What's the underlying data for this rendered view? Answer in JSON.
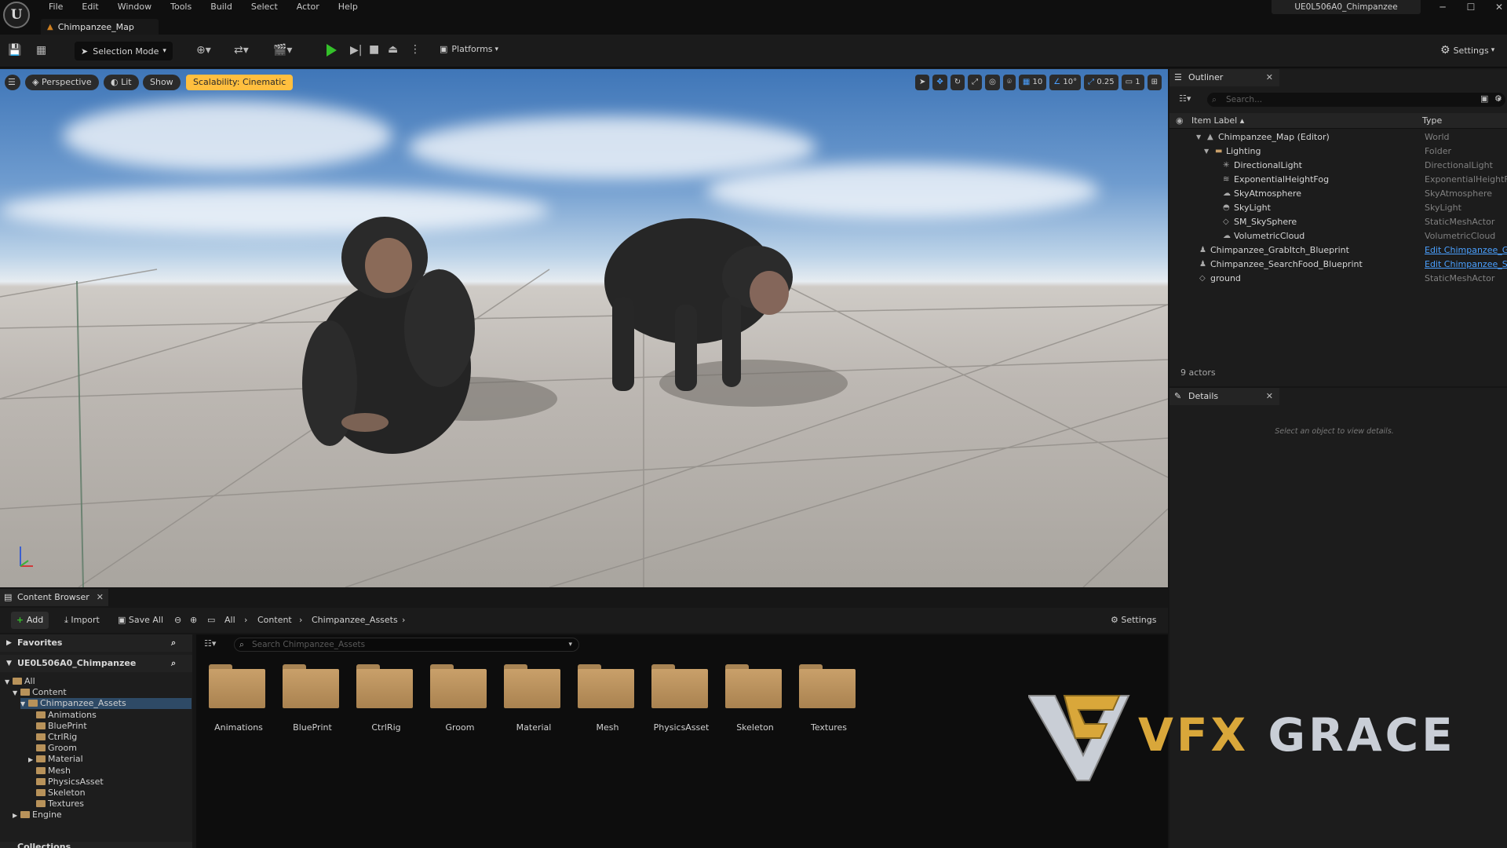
{
  "window": {
    "menu": [
      "File",
      "Edit",
      "Window",
      "Tools",
      "Build",
      "Select",
      "Actor",
      "Help"
    ],
    "map_tab": "Chimpanzee_Map",
    "project_name": "UE0L506A0_Chimpanzee"
  },
  "toolbar": {
    "selection_mode": "Selection Mode",
    "platforms": "Platforms",
    "settings": "Settings"
  },
  "viewport": {
    "perspective": "Perspective",
    "lit": "Lit",
    "show": "Show",
    "scalability": "Scalability: Cinematic",
    "grid_snap": "10",
    "rotation_snap": "10°",
    "scale_snap": "0.25",
    "camera_speed": "1"
  },
  "outliner": {
    "tab": "Outliner",
    "search_placeholder": "Search...",
    "col_label": "Item Label ▴",
    "col_type": "Type",
    "rows": [
      {
        "label": "Chimpanzee_Map (Editor)",
        "type": "World",
        "icon": "map-icon",
        "link": false
      },
      {
        "label": "Lighting",
        "type": "Folder",
        "icon": "folder-icon",
        "link": false
      },
      {
        "label": "DirectionalLight",
        "type": "DirectionalLight",
        "icon": "sun-icon",
        "link": false
      },
      {
        "label": "ExponentialHeightFog",
        "type": "ExponentialHeightFog",
        "icon": "fog-icon",
        "link": false
      },
      {
        "label": "SkyAtmosphere",
        "type": "SkyAtmosphere",
        "icon": "atmosphere-icon",
        "link": false
      },
      {
        "label": "SkyLight",
        "type": "SkyLight",
        "icon": "skylight-icon",
        "link": false
      },
      {
        "label": "SM_SkySphere",
        "type": "StaticMeshActor",
        "icon": "mesh-icon",
        "link": false
      },
      {
        "label": "VolumetricCloud",
        "type": "VolumetricCloud",
        "icon": "cloud-icon",
        "link": false
      },
      {
        "label": "Chimpanzee_GrabItch_Blueprint",
        "type": "Edit Chimpanzee_Gra",
        "icon": "actor-icon",
        "link": true
      },
      {
        "label": "Chimpanzee_SearchFood_Blueprint",
        "type": "Edit Chimpanzee_Se",
        "icon": "actor-icon",
        "link": true
      },
      {
        "label": "ground",
        "type": "StaticMeshActor",
        "icon": "mesh-icon",
        "link": false
      }
    ],
    "actor_count": "9 actors"
  },
  "details": {
    "tab": "Details",
    "empty_message": "Select an object to view details."
  },
  "content_browser": {
    "tab": "Content Browser",
    "add": "Add",
    "import": "Import",
    "save_all": "Save All",
    "breadcrumb": [
      "All",
      "Content",
      "Chimpanzee_Assets"
    ],
    "settings": "Settings",
    "favorites": "Favorites",
    "project": "UE0L506A0_Chimpanzee",
    "collections": "Collections",
    "search_placeholder": "Search Chimpanzee_Assets",
    "tree": [
      {
        "label": "All",
        "depth": 0
      },
      {
        "label": "Content",
        "depth": 1
      },
      {
        "label": "Chimpanzee_Assets",
        "depth": 2
      },
      {
        "label": "Animations",
        "depth": 3
      },
      {
        "label": "BluePrint",
        "depth": 3
      },
      {
        "label": "CtrlRig",
        "depth": 3
      },
      {
        "label": "Groom",
        "depth": 3
      },
      {
        "label": "Material",
        "depth": 3
      },
      {
        "label": "Mesh",
        "depth": 3
      },
      {
        "label": "PhysicsAsset",
        "depth": 3
      },
      {
        "label": "Skeleton",
        "depth": 3
      },
      {
        "label": "Textures",
        "depth": 3
      },
      {
        "label": "Engine",
        "depth": 1
      }
    ],
    "assets": [
      "Animations",
      "BluePrint",
      "CtrlRig",
      "Groom",
      "Material",
      "Mesh",
      "PhysicsAsset",
      "Skeleton",
      "Textures"
    ]
  },
  "watermark": {
    "text_gold": "VFX",
    "text_silver": "GRACE"
  }
}
